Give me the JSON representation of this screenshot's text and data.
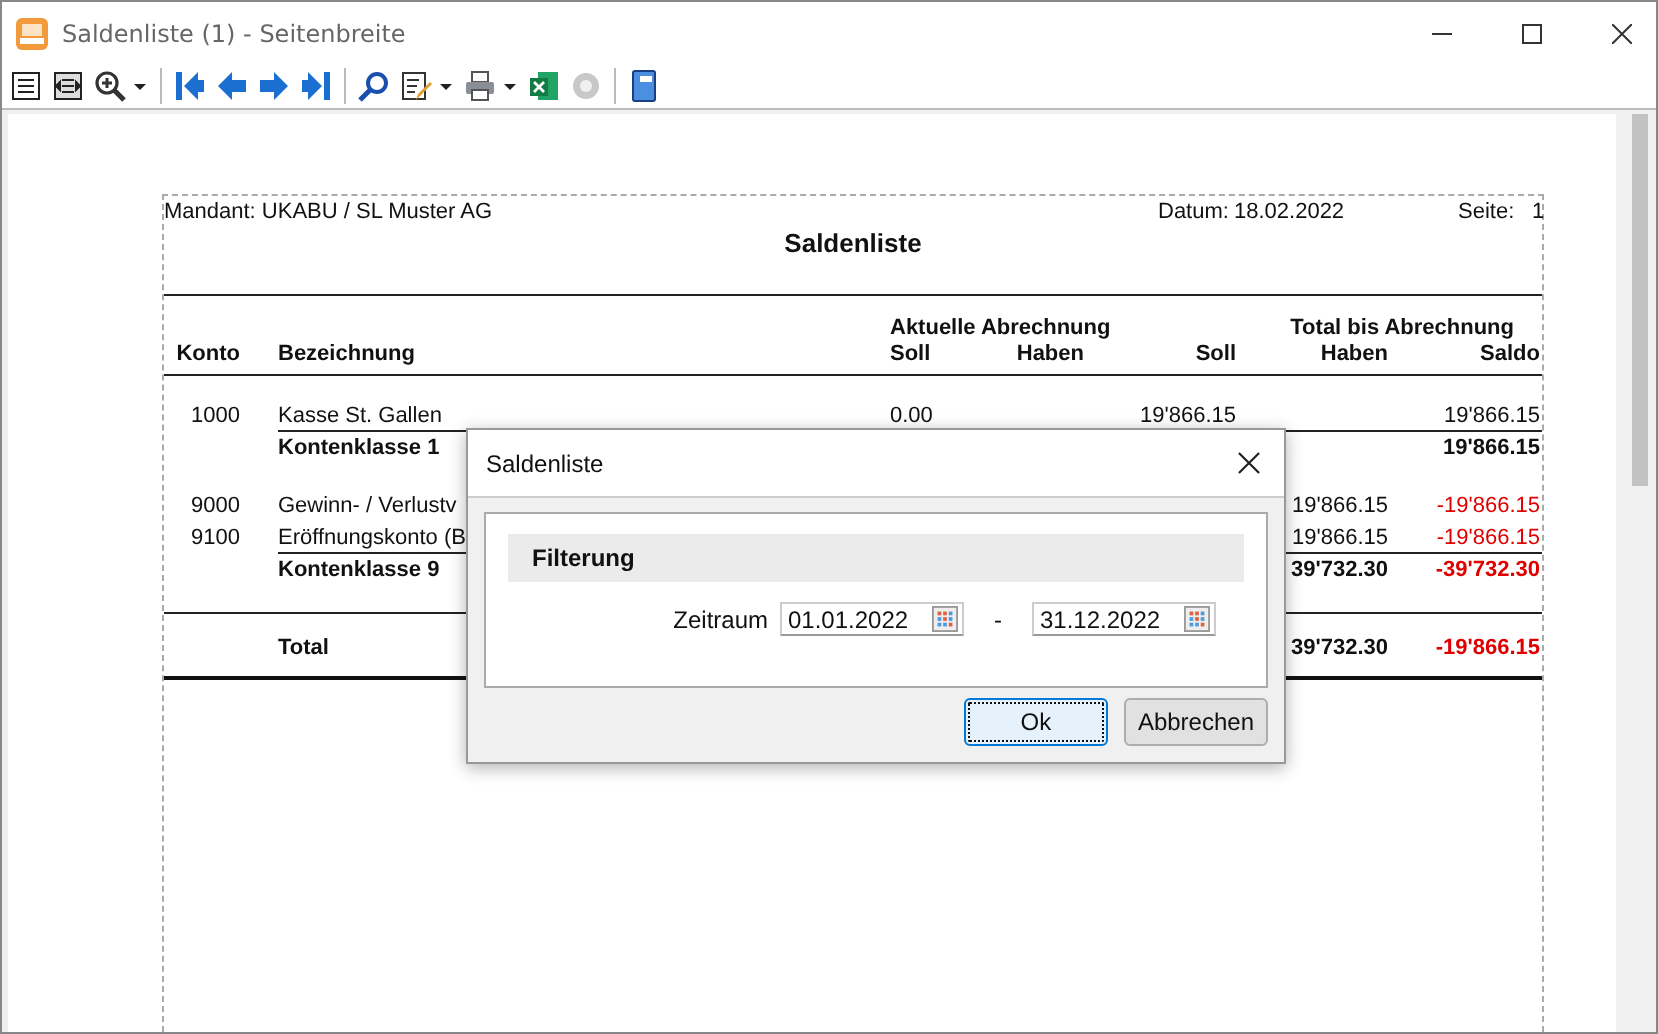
{
  "window": {
    "title": "Saldenliste (1) - Seitenbreite"
  },
  "report": {
    "client": "Mandant:  UKABU  /  SL Muster AG",
    "date_label": "Datum:",
    "date": "18.02.2022",
    "page_label": "Seite:",
    "page": "1",
    "title": "Saldenliste",
    "group_headers": [
      "Aktuelle Abrechnung",
      "Total bis Abrechnung"
    ],
    "columns": [
      "Konto",
      "Bezeichnung",
      "Soll",
      "Haben",
      "Soll",
      "Haben",
      "Saldo"
    ],
    "rows": [
      {
        "kind": "account",
        "konto": "1000",
        "bezeichnung": "Kasse St. Gallen",
        "soll": "0.00",
        "total_soll": "19'866.15",
        "saldo": "19'866.15",
        "saldo_negative": false,
        "rule_below": true
      },
      {
        "kind": "subtotal",
        "bezeichnung": "Kontenklasse 1",
        "saldo": "19'866.15",
        "saldo_negative": false,
        "rule_below": false
      },
      {
        "kind": "account",
        "konto": "9000",
        "bezeichnung": "Gewinn- / Verlustv",
        "total_haben": "19'866.15",
        "saldo": "-19'866.15",
        "saldo_negative": true,
        "rule_below": false
      },
      {
        "kind": "account",
        "konto": "9100",
        "bezeichnung": "Eröffnungskonto (B",
        "total_haben": "19'866.15",
        "saldo": "-19'866.15",
        "saldo_negative": true,
        "rule_below": true
      },
      {
        "kind": "subtotal",
        "bezeichnung": "Kontenklasse 9",
        "total_haben": "39'732.30",
        "saldo": "-39'732.30",
        "saldo_negative": true,
        "rule_below": false
      },
      {
        "kind": "total",
        "bezeichnung": "Total",
        "total_haben": "39'732.30",
        "saldo": "-19'866.15",
        "saldo_negative": true,
        "rule_below": false
      }
    ]
  },
  "dialog": {
    "title": "Saldenliste",
    "section": "Filterung",
    "period_label": "Zeitraum",
    "from": "01.01.2022",
    "separator": "-",
    "to": "31.12.2022",
    "buttons": [
      {
        "label": "Ok",
        "focused": true
      },
      {
        "label": "Abbrechen",
        "focused": false
      }
    ]
  }
}
